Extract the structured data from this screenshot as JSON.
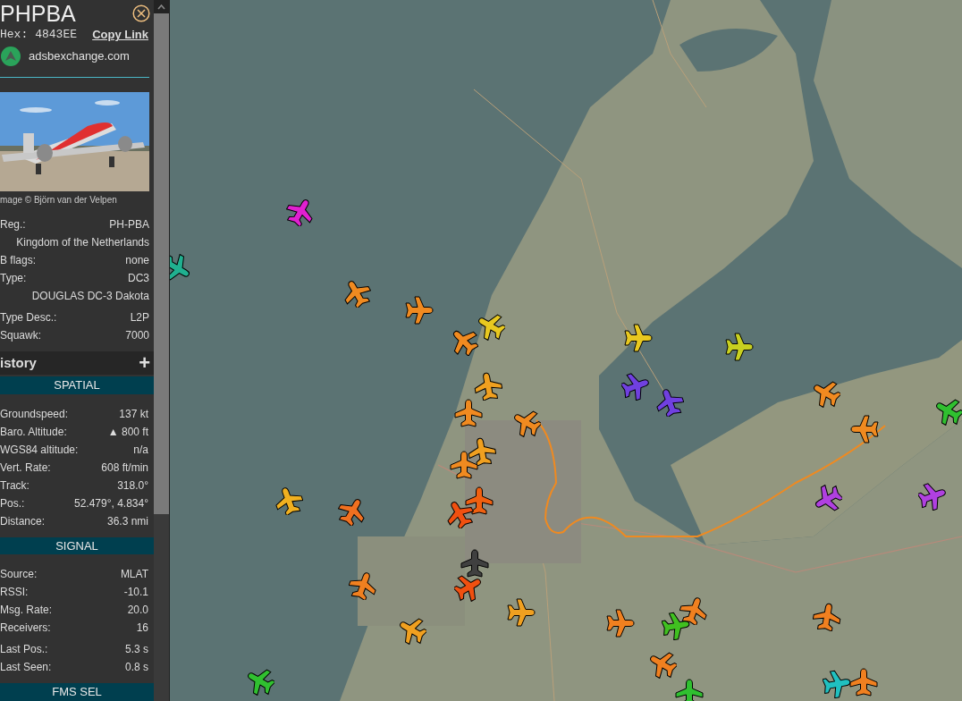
{
  "header": {
    "callsign": "PHPBA",
    "hex_label": "Hex:",
    "hex": "4843EE",
    "copy_link": "Copy Link",
    "source": "adsbexchange.com"
  },
  "photo": {
    "kind": "picture",
    "credit": "mage © Björn van der Velpen"
  },
  "info_groups": [
    [
      {
        "label": "Reg.:",
        "value": "PH-PBA"
      },
      {
        "value": "Kingdom of the Netherlands"
      },
      {
        "label": "B flags:",
        "value": "none"
      },
      {
        "label": "Type:",
        "value": "DC3"
      },
      {
        "value": "DOUGLAS DC-3 Dakota"
      }
    ],
    [
      {
        "label": "Type Desc.:",
        "value": "L2P"
      },
      {
        "label": "Squawk:",
        "value": "7000"
      }
    ]
  ],
  "history": {
    "title": "istory",
    "toggle": "+"
  },
  "sections": [
    {
      "title": "SPATIAL",
      "groups": [
        [
          {
            "label": "Groundspeed:",
            "value": "137 kt"
          },
          {
            "label": "Baro. Altitude:",
            "value": "▲ 800 ft"
          },
          {
            "label": "WGS84 altitude:",
            "value": "n/a"
          },
          {
            "label": "Vert. Rate:",
            "value": "608 ft/min"
          },
          {
            "label": "Track:",
            "value": "318.0°"
          },
          {
            "label": "Pos.:",
            "value": "52.479°, 4.834°"
          },
          {
            "label": "Distance:",
            "value": "36.3 nmi"
          }
        ]
      ]
    },
    {
      "title": "SIGNAL",
      "groups": [
        [
          {
            "label": "Source:",
            "value": "MLAT"
          },
          {
            "label": "RSSI:",
            "value": "-10.1"
          },
          {
            "label": "Msg. Rate:",
            "value": "20.0"
          },
          {
            "label": "Receivers:",
            "value": "16"
          }
        ],
        [
          {
            "label": "Last Pos.:",
            "value": "5.3 s"
          },
          {
            "label": "Last Seen:",
            "value": "0.8 s"
          }
        ]
      ]
    },
    {
      "title": "FMS SEL"
    }
  ],
  "aircraft": [
    {
      "color": "#e020d0"
    },
    {
      "color": "#20b090"
    },
    {
      "color": "#f08a20"
    },
    {
      "color": "#f08a20"
    },
    {
      "color": "#e8c820"
    },
    {
      "color": "#f08a20"
    },
    {
      "color": "#e8c820"
    },
    {
      "color": "#c8d020"
    },
    {
      "color": "#f0a020"
    },
    {
      "color": "#7040e0"
    },
    {
      "color": "#7040e0"
    },
    {
      "color": "#f08a20"
    },
    {
      "color": "#f08a20"
    },
    {
      "color": "#f08a20"
    },
    {
      "color": "#f08a20"
    },
    {
      "color": "#30c030"
    },
    {
      "color": "#f0a020"
    },
    {
      "color": "#f08a20"
    },
    {
      "color": "#f0b020"
    },
    {
      "color": "#f07020"
    },
    {
      "color": "#f06010"
    },
    {
      "color": "#f05010"
    },
    {
      "color": "#b040e0"
    },
    {
      "color": "#b040e0"
    },
    {
      "color": "#404040"
    },
    {
      "color": "#f08020"
    },
    {
      "color": "#f05010"
    },
    {
      "color": "#f0a020"
    },
    {
      "color": "#f0a020"
    },
    {
      "color": "#f08020"
    },
    {
      "color": "#40c020"
    },
    {
      "color": "#f08020"
    },
    {
      "color": "#f08020"
    },
    {
      "color": "#f08020"
    },
    {
      "color": "#30c030"
    },
    {
      "color": "#20c0c0"
    },
    {
      "color": "#f08020"
    },
    {
      "color": "#30c030"
    }
  ]
}
